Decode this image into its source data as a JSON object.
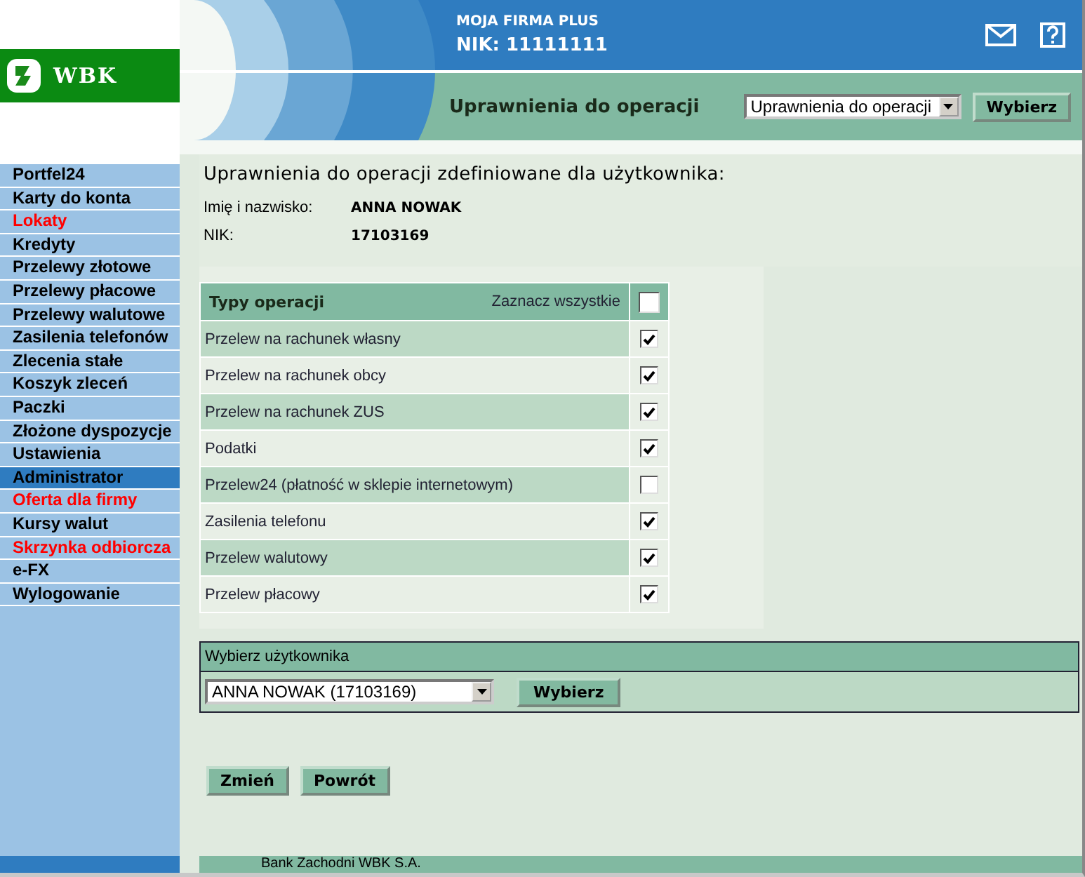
{
  "header": {
    "logo": "WBK",
    "company": "MOJA FIRMA PLUS",
    "nik": "NIK: 11111111",
    "section_title": "Uprawnienia do operacji",
    "section_select": "Uprawnienia do operacji",
    "section_button": "Wybierz"
  },
  "menu": [
    {
      "label": "Portfel24",
      "kind": "normal",
      "selected": false
    },
    {
      "label": "Karty do konta",
      "kind": "normal",
      "selected": false
    },
    {
      "label": "Lokaty",
      "kind": "promo",
      "selected": false
    },
    {
      "label": "Kredyty",
      "kind": "normal",
      "selected": false
    },
    {
      "label": "Przelewy złotowe",
      "kind": "normal",
      "selected": false
    },
    {
      "label": "Przelewy płacowe",
      "kind": "normal",
      "selected": false
    },
    {
      "label": "Przelewy walutowe",
      "kind": "normal",
      "selected": false
    },
    {
      "label": "Zasilenia telefonów",
      "kind": "normal",
      "selected": false
    },
    {
      "label": "Zlecenia stałe",
      "kind": "normal",
      "selected": false
    },
    {
      "label": "Koszyk zleceń",
      "kind": "normal",
      "selected": false
    },
    {
      "label": "Paczki",
      "kind": "normal",
      "selected": false
    },
    {
      "label": "Złożone dyspozycje",
      "kind": "normal",
      "selected": false
    },
    {
      "label": "Ustawienia",
      "kind": "normal",
      "selected": false
    },
    {
      "label": "Administrator",
      "kind": "normal",
      "selected": true
    },
    {
      "label": "Oferta dla firmy",
      "kind": "promo",
      "selected": false
    },
    {
      "label": "Kursy walut",
      "kind": "normal",
      "selected": false
    },
    {
      "label": "Skrzynka odbiorcza",
      "kind": "promo",
      "selected": false
    },
    {
      "label": "e-FX",
      "kind": "normal",
      "selected": false
    },
    {
      "label": "Wylogowanie",
      "kind": "normal",
      "selected": false
    }
  ],
  "info": {
    "heading": "Uprawnienia do operacji zdefiniowane dla użytkownika:",
    "fields": [
      {
        "label": "Imię i nazwisko:",
        "value": "ANNA NOWAK"
      },
      {
        "label": "NIK:",
        "value": "17103169"
      }
    ]
  },
  "table": {
    "header": "Typy operacji",
    "select_all": "Zaznacz wszystkie",
    "select_all_checked": false,
    "rows": [
      {
        "label": "Przelew na rachunek własny",
        "checked": true
      },
      {
        "label": "Przelew na rachunek obcy",
        "checked": true
      },
      {
        "label": "Przelew na rachunek ZUS",
        "checked": true
      },
      {
        "label": "Podatki",
        "checked": true
      },
      {
        "label": "Przelew24 (płatność w sklepie internetowym)",
        "checked": false
      },
      {
        "label": "Zasilenia telefonu",
        "checked": true
      },
      {
        "label": "Przelew walutowy",
        "checked": true
      },
      {
        "label": "Przelew płacowy",
        "checked": true
      }
    ]
  },
  "user_select": {
    "title": "Wybierz użytkownika",
    "value": "ANNA NOWAK (17103169)",
    "button": "Wybierz"
  },
  "buttons": [
    "Zmień",
    "Powrót"
  ],
  "footer": "Bank Zachodni WBK S.A."
}
